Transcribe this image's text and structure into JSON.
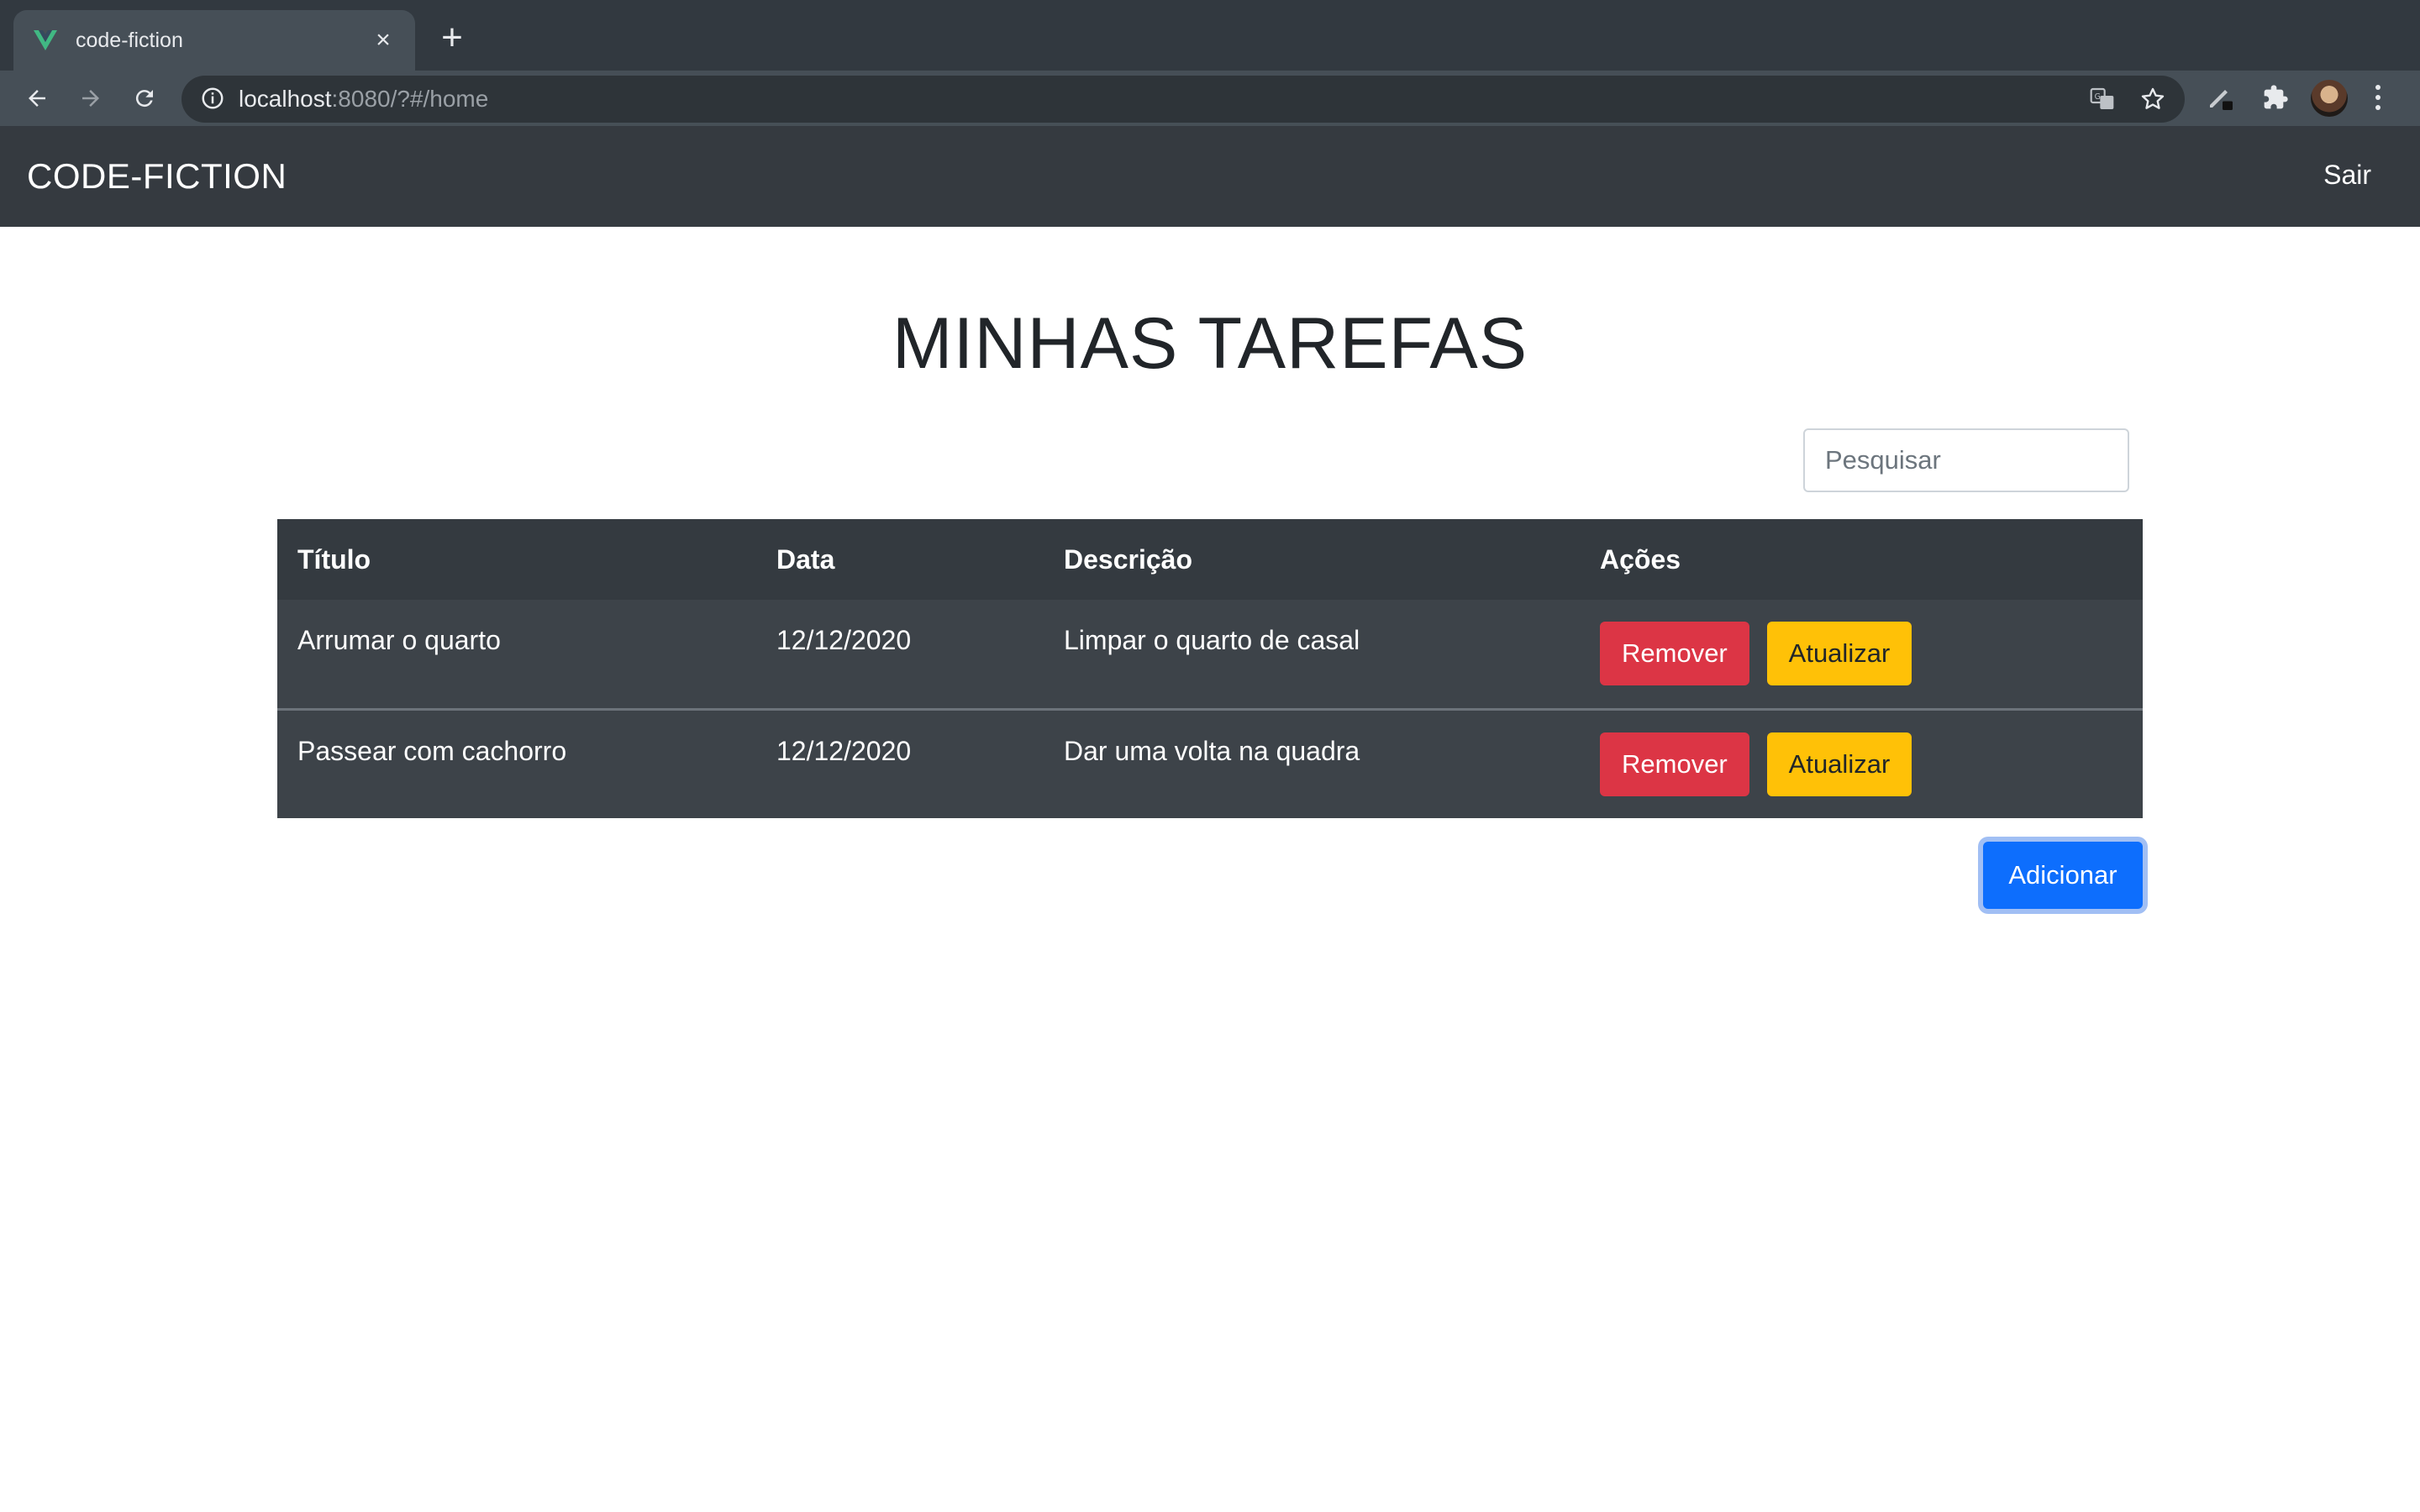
{
  "browser": {
    "tab": {
      "title": "code-fiction",
      "favicon": "vue-logo-icon",
      "close": "×"
    },
    "new_tab": "+",
    "url": {
      "host": "localhost",
      "rest": ":8080/?#/home"
    },
    "icons": [
      "back-arrow-icon",
      "forward-arrow-icon",
      "reload-icon",
      "info-icon",
      "translate-icon",
      "star-icon",
      "pen-extension-icon",
      "puzzle-extension-icon",
      "avatar",
      "menu-dots-icon"
    ]
  },
  "navbar": {
    "brand": "CODE-FICTION",
    "logout": "Sair"
  },
  "main": {
    "title": "MINHAS TAREFAS",
    "search": {
      "placeholder": "Pesquisar",
      "value": ""
    },
    "table": {
      "headers": {
        "titulo": "Título",
        "data": "Data",
        "descricao": "Descrição",
        "acoes": "Ações"
      },
      "rows": [
        {
          "titulo": "Arrumar o quarto",
          "data": "12/12/2020",
          "descricao": "Limpar o quarto de casal",
          "remove": "Remover",
          "update": "Atualizar"
        },
        {
          "titulo": "Passear com cachorro",
          "data": "12/12/2020",
          "descricao": "Dar uma volta na quadra",
          "remove": "Remover",
          "update": "Atualizar"
        }
      ]
    },
    "add_button": "Adicionar"
  },
  "colors": {
    "navbar": "#353a40",
    "table_header": "#343a40",
    "table_row": "#3d4349",
    "danger": "#dc3545",
    "warning": "#ffc107",
    "primary": "#0d6efd",
    "vue_green": "#41b883"
  }
}
